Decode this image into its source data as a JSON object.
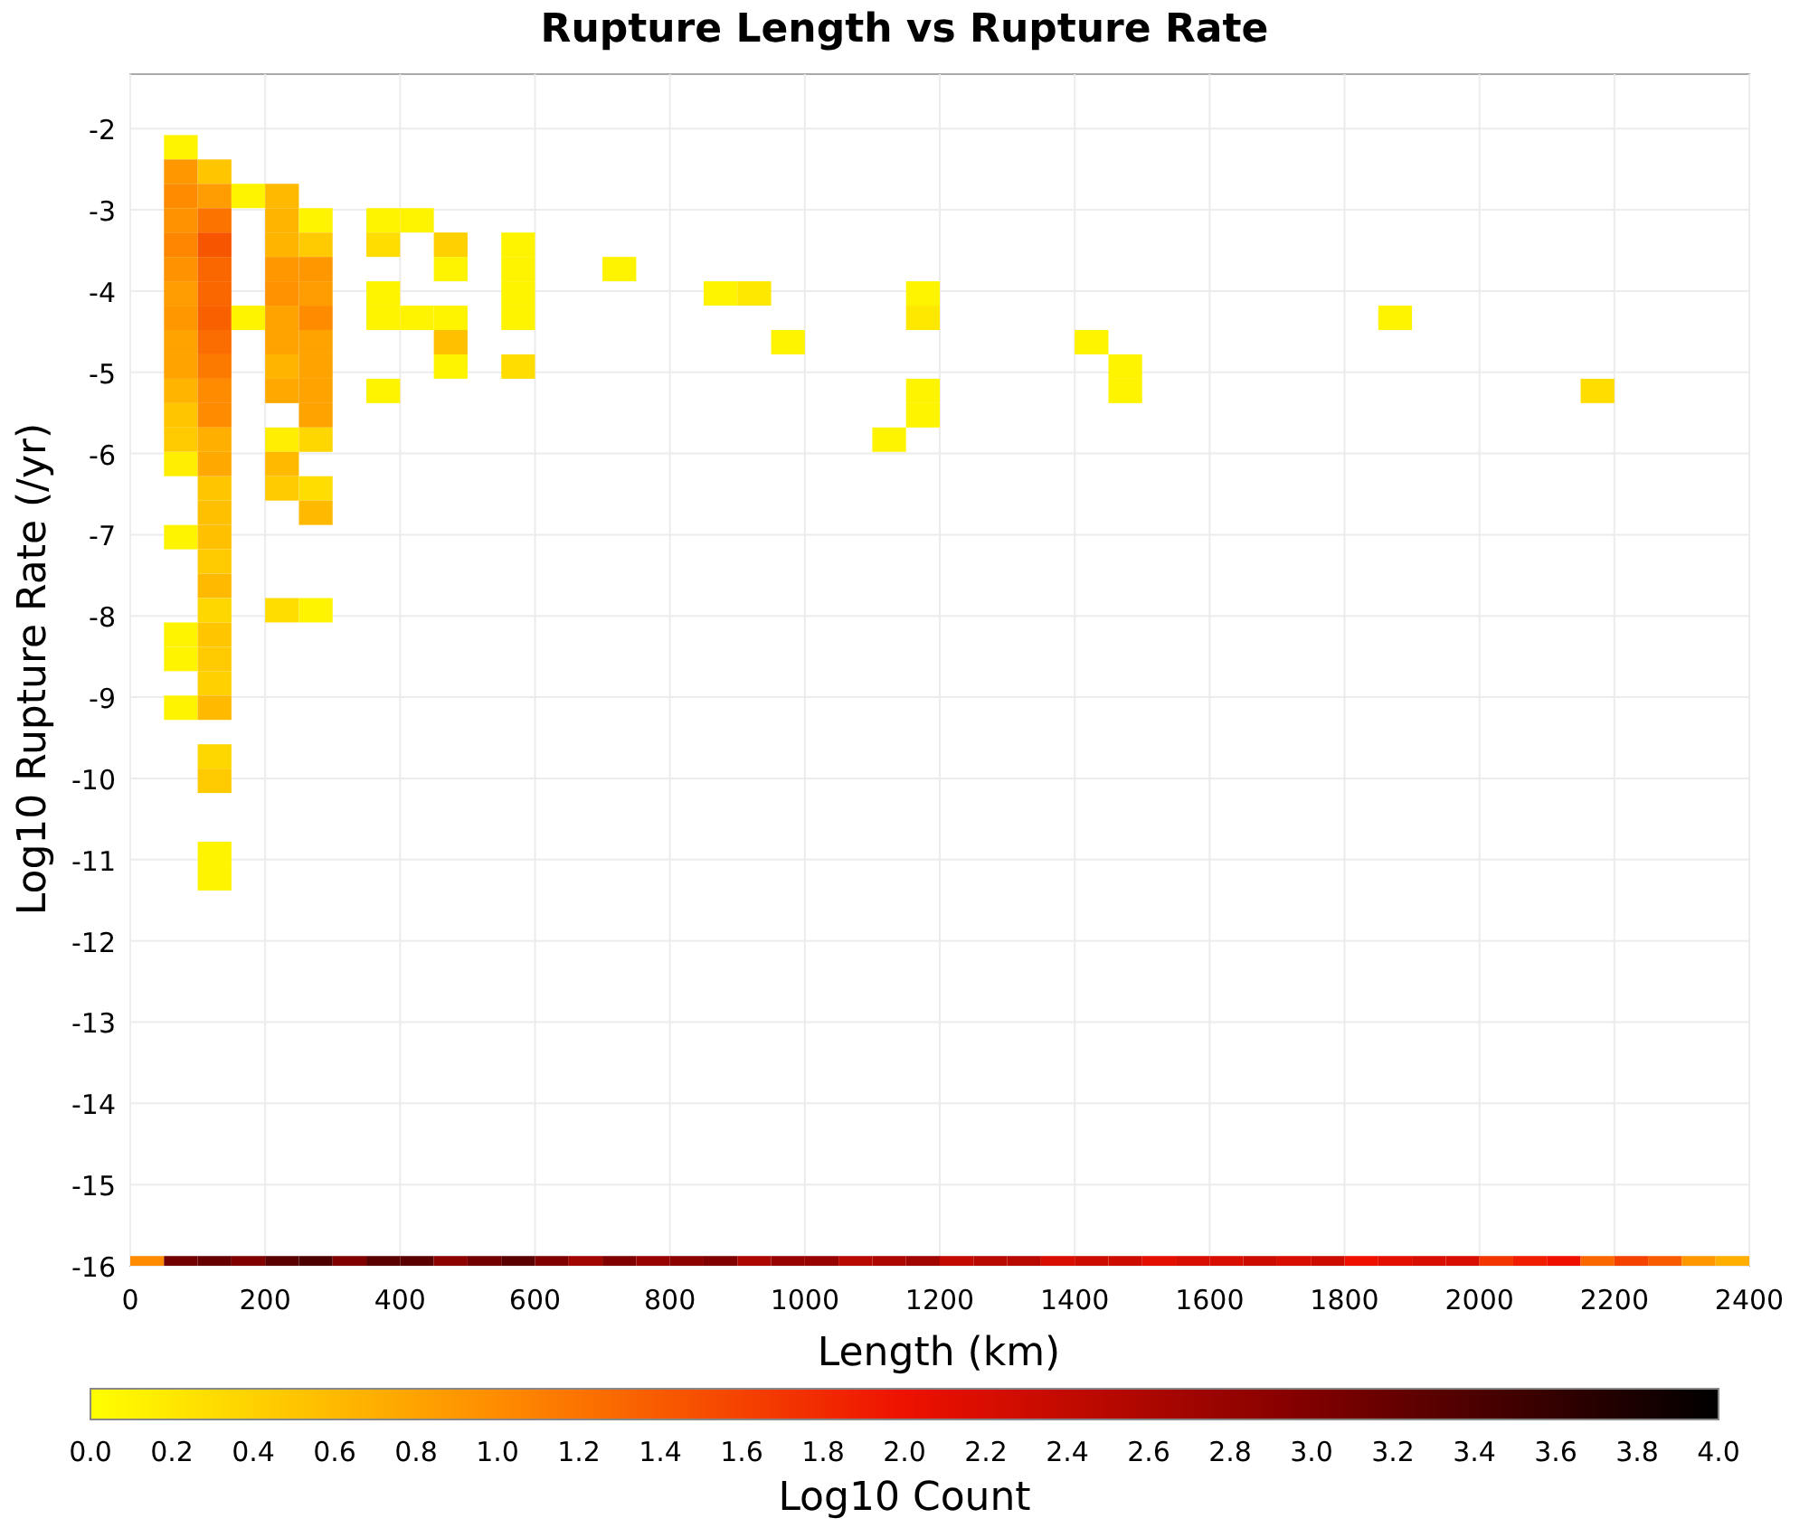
{
  "chart": {
    "title": "Rupture Length vs Rupture Rate",
    "xlabel": "Length (km)",
    "ylabel": "Log10 Rupture Rate (/yr)",
    "x_ticks": [
      "0",
      "200",
      "400",
      "600",
      "800",
      "1000",
      "1200",
      "1400",
      "1600",
      "1800",
      "2000",
      "2200",
      "2400"
    ],
    "y_ticks": [
      "-2",
      "-3",
      "-4",
      "-5",
      "-6",
      "-7",
      "-8",
      "-9",
      "-10",
      "-11",
      "-12",
      "-13",
      "-14",
      "-15",
      "-16"
    ]
  },
  "color_scale": {
    "title": "Log10 Count",
    "ticks": [
      "0.0",
      "0.2",
      "0.4",
      "0.6",
      "0.8",
      "1.0",
      "1.2",
      "1.4",
      "1.6",
      "1.8",
      "2.0",
      "2.2",
      "2.4",
      "2.6",
      "2.8",
      "3.0",
      "3.2",
      "3.4",
      "3.6",
      "3.8",
      "4.0"
    ]
  }
}
